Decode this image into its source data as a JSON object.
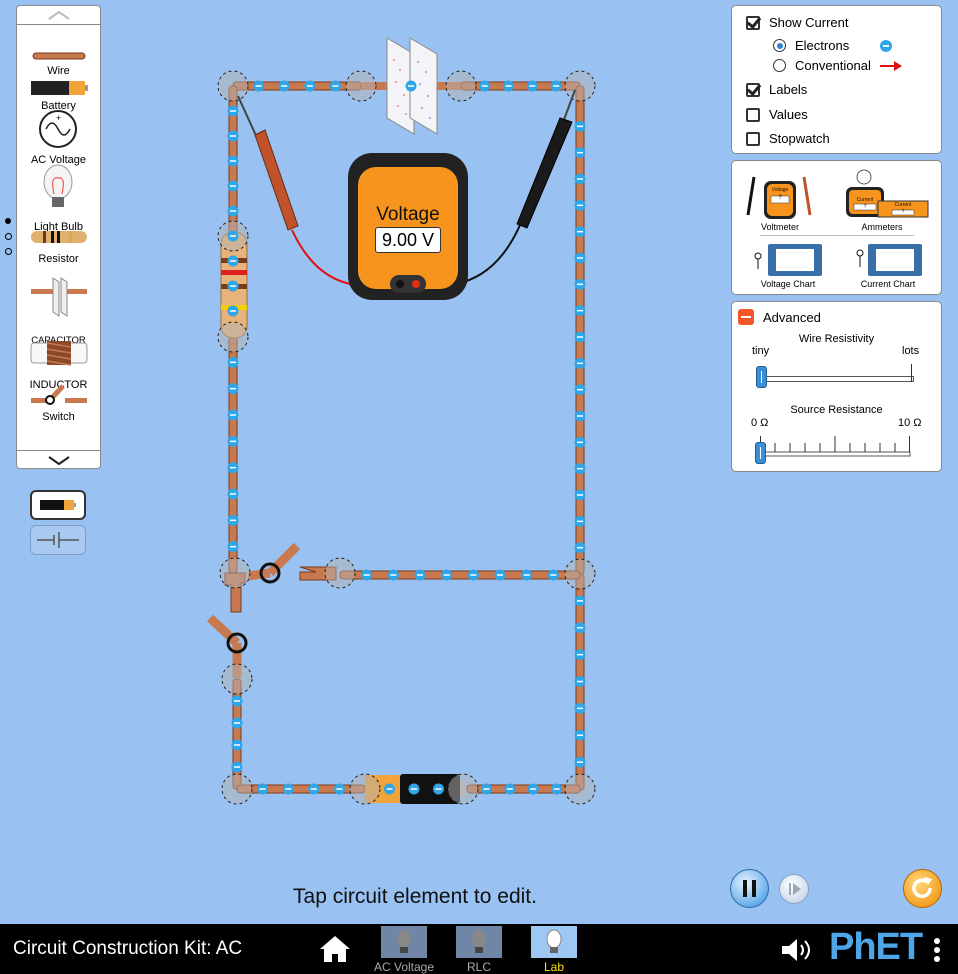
{
  "toolbox": {
    "items": [
      {
        "id": "wire",
        "label": "Wire"
      },
      {
        "id": "battery",
        "label": "Battery"
      },
      {
        "id": "ac-voltage",
        "label": "AC Voltage"
      },
      {
        "id": "light-bulb",
        "label": "Light Bulb"
      },
      {
        "id": "resistor",
        "label": "Resistor"
      },
      {
        "id": "capacitor",
        "label": "CAPACITOR"
      },
      {
        "id": "inductor",
        "label": "INDUCTOR"
      },
      {
        "id": "switch",
        "label": "Switch"
      }
    ]
  },
  "display_options": {
    "show_current": {
      "label": "Show Current",
      "checked": true
    },
    "electrons": {
      "label": "Electrons",
      "selected": true
    },
    "conventional": {
      "label": "Conventional",
      "selected": false
    },
    "labels": {
      "label": "Labels",
      "checked": true
    },
    "values": {
      "label": "Values",
      "checked": false
    },
    "stopwatch": {
      "label": "Stopwatch",
      "checked": false
    }
  },
  "sensors": {
    "voltmeter": "Voltmeter",
    "ammeters": "Ammeters",
    "voltage_chart": "Voltage Chart",
    "current_chart": "Current Chart",
    "icon_voltage_text": "Voltage",
    "icon_current_text": "Current",
    "icon_q": "?"
  },
  "advanced": {
    "title": "Advanced",
    "wire_resistivity": {
      "label": "Wire Resistivity",
      "min_label": "tiny",
      "max_label": "lots",
      "value": 0
    },
    "source_resistance": {
      "label": "Source Resistance",
      "min_label": "0 Ω",
      "max_label": "10 Ω",
      "value": 0
    }
  },
  "voltmeter_reading": {
    "title": "Voltage",
    "value": "9.00 V"
  },
  "hint": "Tap circuit element to edit.",
  "footer": {
    "sim_title": "Circuit Construction Kit: AC",
    "screens": [
      {
        "label": "AC Voltage",
        "active": false
      },
      {
        "label": "RLC",
        "active": false
      },
      {
        "label": "Lab",
        "active": true
      }
    ],
    "logo": "PhET"
  },
  "colors": {
    "background": "#99c1f1",
    "wire": "#c8794f",
    "electron": "#2ea6e8",
    "battery_orange": "#f2a33a",
    "voltmeter_orange": "#f7941d",
    "lab_active": "#f5e400"
  }
}
